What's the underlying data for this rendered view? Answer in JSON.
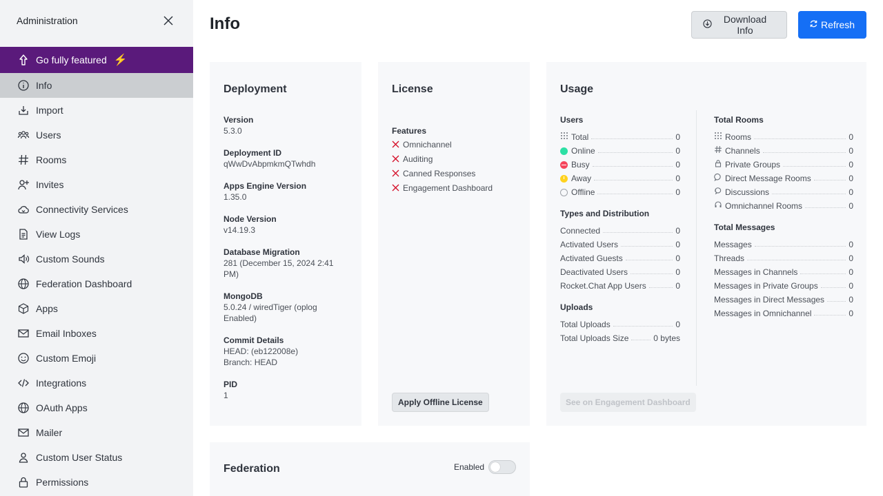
{
  "sidebar": {
    "title": "Administration",
    "featured": {
      "label": "Go fully featured",
      "bolt": "⚡",
      "color": "#5a1a7b"
    },
    "items": [
      {
        "label": "Info",
        "icon": "info-icon",
        "active": true
      },
      {
        "label": "Import",
        "icon": "import-icon"
      },
      {
        "label": "Users",
        "icon": "users-icon"
      },
      {
        "label": "Rooms",
        "icon": "hash-icon"
      },
      {
        "label": "Invites",
        "icon": "user-plus-icon"
      },
      {
        "label": "Connectivity Services",
        "icon": "cloud-icon"
      },
      {
        "label": "View Logs",
        "icon": "file-icon"
      },
      {
        "label": "Custom Sounds",
        "icon": "speaker-icon"
      },
      {
        "label": "Federation Dashboard",
        "icon": "globe-icon"
      },
      {
        "label": "Apps",
        "icon": "cube-icon"
      },
      {
        "label": "Email Inboxes",
        "icon": "mail-icon"
      },
      {
        "label": "Custom Emoji",
        "icon": "emoji-icon"
      },
      {
        "label": "Integrations",
        "icon": "code-icon"
      },
      {
        "label": "OAuth Apps",
        "icon": "globe-icon"
      },
      {
        "label": "Mailer",
        "icon": "mail-icon"
      },
      {
        "label": "Custom User Status",
        "icon": "user-icon"
      },
      {
        "label": "Permissions",
        "icon": "lock-icon"
      }
    ]
  },
  "header": {
    "title": "Info",
    "download_label": "Download Info",
    "refresh_label": "Refresh",
    "accent": "#156ff5"
  },
  "deployment": {
    "title": "Deployment",
    "fields": [
      {
        "label": "Version",
        "value": "5.3.0"
      },
      {
        "label": "Deployment ID",
        "value": "qWwDvAbpmkmQTwhdh"
      },
      {
        "label": "Apps Engine Version",
        "value": "1.35.0"
      },
      {
        "label": "Node Version",
        "value": "v14.19.3"
      },
      {
        "label": "Database Migration",
        "value": "281 (December 15, 2024 2:41 PM)"
      },
      {
        "label": "MongoDB",
        "value": "5.0.24 / wiredTiger (oplog Enabled)"
      },
      {
        "label": "Commit Details",
        "value": "HEAD: (eb122008e)",
        "value2": "Branch: HEAD"
      },
      {
        "label": "PID",
        "value": "1"
      }
    ]
  },
  "license": {
    "title": "License",
    "features_label": "Features",
    "features": [
      "Omnichannel",
      "Auditing",
      "Canned Responses",
      "Engagement Dashboard"
    ],
    "apply_label": "Apply Offline License"
  },
  "usage": {
    "title": "Usage",
    "users": {
      "label": "Users",
      "rows": [
        {
          "name": "Total",
          "value": "0",
          "icon": "users-grid-icon"
        },
        {
          "name": "Online",
          "value": "0",
          "status": "online",
          "color": "#2de0a5"
        },
        {
          "name": "Busy",
          "value": "0",
          "status": "busy",
          "color": "#f5455c"
        },
        {
          "name": "Away",
          "value": "0",
          "status": "away",
          "color": "#ffd21f"
        },
        {
          "name": "Offline",
          "value": "0",
          "status": "offline",
          "color": "#cbced1"
        }
      ]
    },
    "types": {
      "label": "Types and Distribution",
      "rows": [
        {
          "name": "Connected",
          "value": "0"
        },
        {
          "name": "Activated Users",
          "value": "0"
        },
        {
          "name": "Activated Guests",
          "value": "0"
        },
        {
          "name": "Deactivated Users",
          "value": "0"
        },
        {
          "name": "Rocket.Chat App Users",
          "value": "0"
        }
      ]
    },
    "uploads": {
      "label": "Uploads",
      "rows": [
        {
          "name": "Total Uploads",
          "value": "0"
        },
        {
          "name": "Total Uploads Size",
          "value": "0 bytes"
        }
      ]
    },
    "rooms": {
      "label": "Total Rooms",
      "rows": [
        {
          "name": "Rooms",
          "value": "0",
          "icon": "grid-icon"
        },
        {
          "name": "Channels",
          "value": "0",
          "icon": "hash-icon"
        },
        {
          "name": "Private Groups",
          "value": "0",
          "icon": "lock-icon"
        },
        {
          "name": "Direct Message Rooms",
          "value": "0",
          "icon": "chat-icon"
        },
        {
          "name": "Discussions",
          "value": "0",
          "icon": "discussion-icon"
        },
        {
          "name": "Omnichannel Rooms",
          "value": "0",
          "icon": "headset-icon"
        }
      ]
    },
    "messages": {
      "label": "Total Messages",
      "rows": [
        {
          "name": "Messages",
          "value": "0"
        },
        {
          "name": "Threads",
          "value": "0"
        },
        {
          "name": "Messages in Channels",
          "value": "0"
        },
        {
          "name": "Messages in Private Groups",
          "value": "0"
        },
        {
          "name": "Messages in Direct Messages",
          "value": "0"
        },
        {
          "name": "Messages in Omnichannel",
          "value": "0"
        }
      ]
    },
    "engagement_label": "See on Engagement Dashboard"
  },
  "federation": {
    "title": "Federation",
    "enabled_label": "Enabled",
    "enabled": false
  }
}
